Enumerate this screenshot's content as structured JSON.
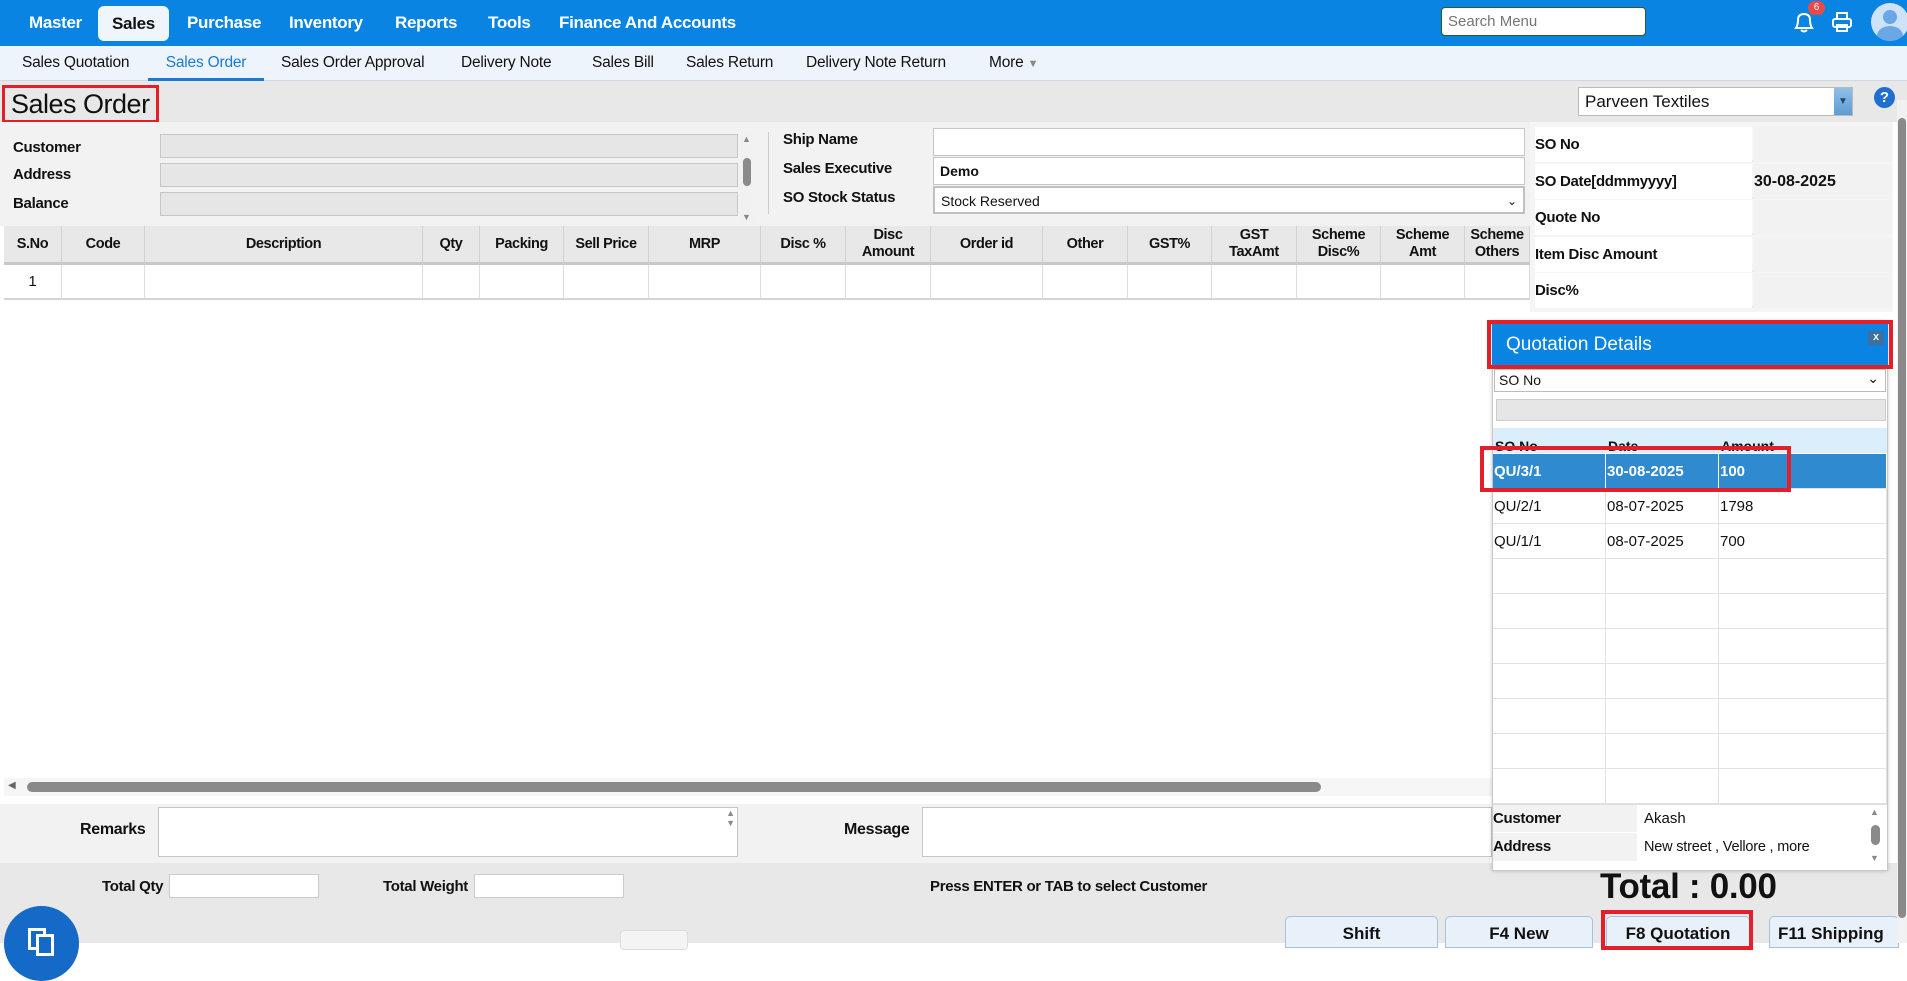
{
  "topnav": {
    "items": [
      "Master",
      "Sales",
      "Purchase",
      "Inventory",
      "Reports",
      "Tools",
      "Finance And Accounts"
    ],
    "active": "Sales",
    "search_placeholder": "Search Menu",
    "notification_count": "6"
  },
  "subnav": {
    "items": [
      "Sales Quotation",
      "Sales Order",
      "Sales Order Approval",
      "Delivery Note",
      "Sales Bill",
      "Sales Return",
      "Delivery Note Return",
      "More"
    ],
    "active": "Sales Order"
  },
  "page": {
    "title": "Sales Order",
    "company": "Parveen Textiles",
    "help": "?"
  },
  "form": {
    "customer_label": "Customer",
    "address_label": "Address",
    "balance_label": "Balance",
    "ship_name_label": "Ship Name",
    "ship_name": "",
    "sales_exec_label": "Sales Executive",
    "sales_exec": "Demo",
    "stock_status_label": "SO Stock Status",
    "stock_status": "Stock Reserved"
  },
  "info": [
    {
      "label": "SO No",
      "value": ""
    },
    {
      "label": "SO Date[ddmmyyyy]",
      "value": "30-08-2025"
    },
    {
      "label": "Quote No",
      "value": ""
    },
    {
      "label": "Item Disc Amount",
      "value": ""
    },
    {
      "label": "Disc%",
      "value": ""
    }
  ],
  "grid": {
    "columns": [
      "S.No",
      "Code",
      "Description",
      "Qty",
      "Packing",
      "Sell Price",
      "MRP",
      "Disc %",
      "Disc\nAmount",
      "Order id",
      "Other",
      "GST%",
      "GST\nTaxAmt",
      "Scheme\nDisc%",
      "Scheme\nAmt",
      "Scheme\nOthers"
    ],
    "rows": [
      [
        "1",
        "",
        "",
        "",
        "",
        "",
        "",
        "",
        "",
        "",
        "",
        "",
        "",
        "",
        "",
        ""
      ]
    ]
  },
  "footer": {
    "remarks_label": "Remarks",
    "message_label": "Message",
    "total_qty_label": "Total Qty",
    "total_weight_label": "Total Weight",
    "hint": "Press ENTER or TAB to select Customer",
    "total": "Total : 0.00"
  },
  "buttons": {
    "shift": "Shift",
    "new": "F4 New",
    "quotation": "F8 Quotation",
    "shipping": "F11 Shipping"
  },
  "popup": {
    "title": "Quotation Details",
    "close": "x",
    "filter": "SO No",
    "columns": [
      "SO No",
      "Date",
      "Amount"
    ],
    "rows": [
      [
        "QU/3/1",
        "30-08-2025",
        "100"
      ],
      [
        "QU/2/1",
        "08-07-2025",
        "1798"
      ],
      [
        "QU/1/1",
        "08-07-2025",
        "700"
      ]
    ],
    "selected_index": 0,
    "customer_label": "Customer",
    "customer": "Akash",
    "address_label": "Address",
    "address": "New street , Vellore , more"
  }
}
